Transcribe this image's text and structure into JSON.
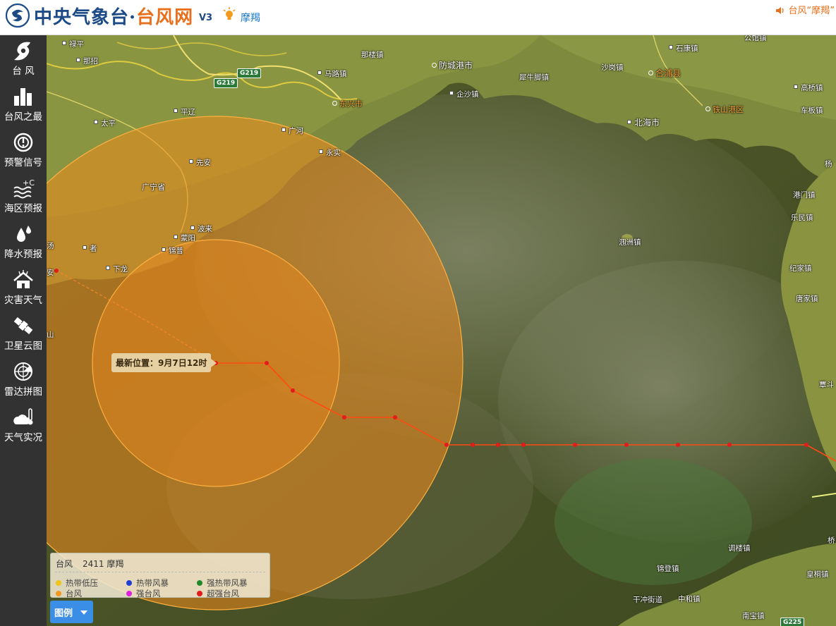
{
  "header": {
    "title_part1": "中央气象台·",
    "title_part2": "台风网",
    "version": "V3",
    "storm_name": "摩羯",
    "right_text": "台风“摩羯”"
  },
  "sidebar": {
    "items": [
      {
        "label": "台 风",
        "icon": "typhoon-icon"
      },
      {
        "label": "台风之最",
        "icon": "bar-chart-icon"
      },
      {
        "label": "预警信号",
        "icon": "warning-signal-icon"
      },
      {
        "label": "海区预报",
        "icon": "sea-forecast-icon"
      },
      {
        "label": "降水预报",
        "icon": "rain-drop-icon"
      },
      {
        "label": "灾害天气",
        "icon": "disaster-house-icon"
      },
      {
        "label": "卫星云图",
        "icon": "satellite-icon"
      },
      {
        "label": "雷达拼图",
        "icon": "radar-icon"
      },
      {
        "label": "天气实况",
        "icon": "weather-thermometer-icon"
      }
    ]
  },
  "map": {
    "tooltip": "最新位置：9月7日12时",
    "places": [
      {
        "name": "禄平"
      },
      {
        "name": "那招"
      },
      {
        "name": "那楼镇"
      },
      {
        "name": "马路镇"
      },
      {
        "name": "防城港市"
      },
      {
        "name": "东兴市"
      },
      {
        "name": "企沙镇"
      },
      {
        "name": "犀牛脚镇"
      },
      {
        "name": "沙岗镇"
      },
      {
        "name": "合浦县"
      },
      {
        "name": "石康镇"
      },
      {
        "name": "公馆镇"
      },
      {
        "name": "高桥镇"
      },
      {
        "name": "铁山港区"
      },
      {
        "name": "车板镇"
      },
      {
        "name": "北海市"
      },
      {
        "name": "平辽"
      },
      {
        "name": "太平"
      },
      {
        "name": "广河"
      },
      {
        "name": "永实"
      },
      {
        "name": "先安"
      },
      {
        "name": "广宁省"
      },
      {
        "name": "波来"
      },
      {
        "name": "蒙阳"
      },
      {
        "name": "锦普"
      },
      {
        "name": "者"
      },
      {
        "name": "下龙"
      },
      {
        "name": "涠洲镇"
      },
      {
        "name": "港门镇"
      },
      {
        "name": "乐民镇"
      },
      {
        "name": "纪家镇"
      },
      {
        "name": "唐家镇"
      },
      {
        "name": "杨"
      },
      {
        "name": "覃斗"
      },
      {
        "name": "调楼镇"
      },
      {
        "name": "锦登镇"
      },
      {
        "name": "皇桐镇"
      },
      {
        "name": "干冲街道"
      },
      {
        "name": "中和镇"
      },
      {
        "name": "南宝镇"
      },
      {
        "name": "桥"
      },
      {
        "name": "安"
      },
      {
        "name": "山"
      },
      {
        "name": "汤"
      }
    ],
    "roads": [
      "G219",
      "G219",
      "G225"
    ]
  },
  "legend": {
    "typhoon_label": "台风",
    "typhoon_id": "2411 摩羯",
    "items": [
      {
        "label": "热带低压",
        "color": "#f0c419"
      },
      {
        "label": "热带风暴",
        "color": "#1f3fd6"
      },
      {
        "label": "强热带风暴",
        "color": "#1f8a2a"
      },
      {
        "label": "台风",
        "color": "#f39a1e"
      },
      {
        "label": "强台风",
        "color": "#e020e0"
      },
      {
        "label": "超强台风",
        "color": "#e31b1b"
      }
    ],
    "button_label": "图例"
  },
  "colors": {
    "brand_blue": "#1b4a86",
    "brand_orange": "#e8701c",
    "track": "#ff4a12",
    "track_point": "#e31b1b"
  }
}
